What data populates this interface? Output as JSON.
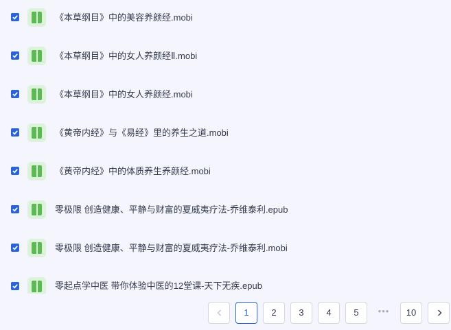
{
  "files": [
    {
      "name": "《本草纲目》中的美容养颜经.mobi",
      "checked": true
    },
    {
      "name": "《本草纲目》中的女人养颜经Ⅱ.mobi",
      "checked": true
    },
    {
      "name": "《本草纲目》中的女人养颜经.mobi",
      "checked": true
    },
    {
      "name": "《黄帝内经》与《易经》里的养生之道.mobi",
      "checked": true
    },
    {
      "name": "《黄帝内经》中的体质养生养颜经.mobi",
      "checked": true
    },
    {
      "name": "零极限 创造健康、平静与财富的夏威夷疗法-乔维泰利.epub",
      "checked": true
    },
    {
      "name": "零极限 创造健康、平静与财富的夏威夷疗法-乔维泰利.mobi",
      "checked": true
    },
    {
      "name": "零起点学中医 带你体验中医的12堂课-天下无疾.epub",
      "checked": true
    }
  ],
  "pagination": {
    "pages": [
      "1",
      "2",
      "3",
      "4",
      "5"
    ],
    "ellipsis": "•••",
    "last_page": "10",
    "current": "1"
  },
  "colors": {
    "accent": "#2a64d6",
    "file_icon_bg": "#dcf2da",
    "file_icon": "#5cba55",
    "background": "#f5f6fd"
  }
}
